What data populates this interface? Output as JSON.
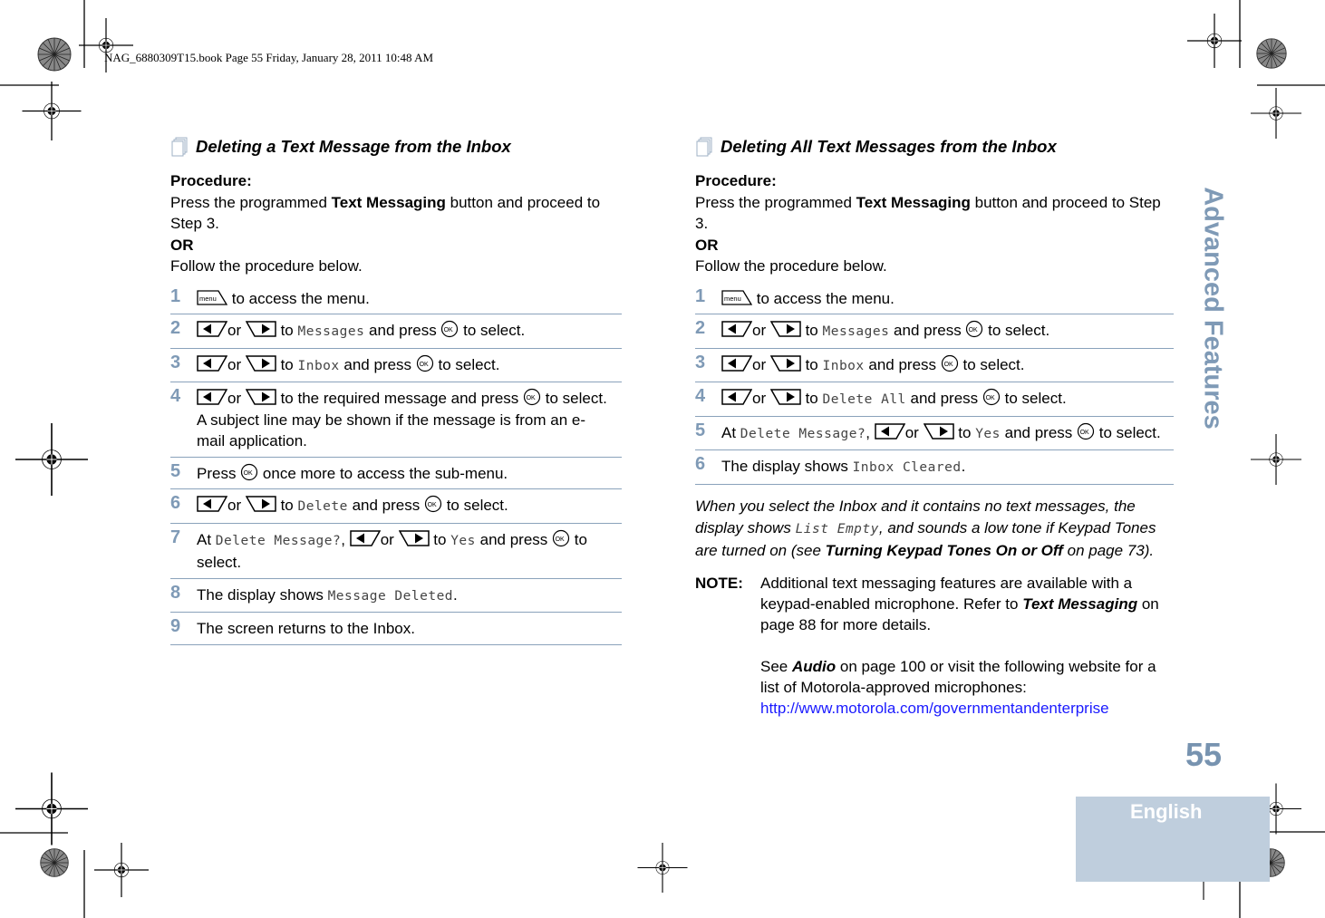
{
  "header": {
    "print_line": "NAG_6880309T15.book  Page 55  Friday, January 28, 2011  10:48 AM"
  },
  "side_tab": {
    "label": "Advanced Features"
  },
  "page_number": "55",
  "language_tab": {
    "label": "English"
  },
  "colors": {
    "accent": "#7f9ab6",
    "rule": "#8aa2bb",
    "lang_tab_bg": "#bfcedd",
    "link": "#1a1aff"
  },
  "left": {
    "title": "Deleting a Text Message from the Inbox",
    "procedure_label": "Procedure:",
    "intro_pre": "Press the programmed ",
    "intro_bold": "Text Messaging",
    "intro_post": " button and proceed to Step 3.",
    "or_label": "OR",
    "follow": "Follow the procedure below.",
    "steps": [
      {
        "num": "1",
        "text": " to access the menu."
      },
      {
        "num": "2",
        "or": "or",
        "to": " to ",
        "lcd": "Messages",
        "press": " and press ",
        "end": " to select."
      },
      {
        "num": "3",
        "or": "or",
        "to": " to ",
        "lcd": "Inbox",
        "press": " and press ",
        "end": " to select."
      },
      {
        "num": "4",
        "or": "or",
        "to": " to the required message and press ",
        "end": " to select.",
        "extra": "A subject line may be shown if the message is from an e-mail application."
      },
      {
        "num": "5",
        "pre": "Press ",
        "end": " once more to access the sub-menu."
      },
      {
        "num": "6",
        "or": "or",
        "to": " to ",
        "lcd": "Delete",
        "press": " and press ",
        "end": " to select."
      },
      {
        "num": "7",
        "at": "At ",
        "lcd": "Delete Message?",
        "comma": ", ",
        "or": "or",
        "to": " to ",
        "lcd2": "Yes",
        "press": " and press ",
        "end": " to select."
      },
      {
        "num": "8",
        "pre": "The display shows ",
        "lcd": "Message Deleted",
        "end": "."
      },
      {
        "num": "9",
        "pre": "The screen returns to the Inbox."
      }
    ]
  },
  "right": {
    "title": "Deleting All Text Messages from the Inbox",
    "procedure_label": "Procedure:",
    "intro_pre": "Press the programmed ",
    "intro_bold": "Text Messaging",
    "intro_post": " button and proceed to Step 3.",
    "or_label": "OR",
    "follow": "Follow the procedure below.",
    "steps": [
      {
        "num": "1",
        "text": " to access the menu."
      },
      {
        "num": "2",
        "or": "or",
        "to": " to ",
        "lcd": "Messages",
        "press": " and press ",
        "end": " to select."
      },
      {
        "num": "3",
        "or": "or",
        "to": " to ",
        "lcd": "Inbox",
        "press": " and press ",
        "end": " to select."
      },
      {
        "num": "4",
        "or": "or",
        "to": " to ",
        "lcd": "Delete All",
        "press": " and press ",
        "end": " to select."
      },
      {
        "num": "5",
        "at": "At ",
        "lcd": "Delete Message?",
        "comma": ", ",
        "or": "or",
        "to": " to ",
        "lcd2": "Yes",
        "press": " and press ",
        "end": " to select."
      },
      {
        "num": "6",
        "pre": "The display shows ",
        "lcd": "Inbox Cleared",
        "end": "."
      }
    ],
    "empty_note": {
      "p1": "When you select the Inbox and it contains no text messages, the display shows ",
      "lcd": "List Empty",
      "p2": ", and sounds a low tone if Keypad Tones are turned on (see ",
      "bold": "Turning Keypad Tones On or Off",
      "p3": " on page 73)."
    },
    "note": {
      "label": "NOTE:",
      "p1": "Additional text messaging features are available with a keypad-enabled microphone. Refer to ",
      "bold1": "Text Messaging",
      "p2": " on page 88 for more details.",
      "p3": "See ",
      "bold2": "Audio",
      "p4": " on page 100 or visit the following website for a list of Motorola-approved microphones:",
      "link": "http://www.motorola.com/governmentandenterprise"
    }
  },
  "icons": {
    "section": "document-stack-icon",
    "menu_key": "menu-key-icon",
    "left_key": "left-arrow-key-icon",
    "right_key": "right-arrow-key-icon",
    "ok_key": "ok-button-icon",
    "menu_key_label": "menu",
    "ok_key_label": "OK"
  }
}
